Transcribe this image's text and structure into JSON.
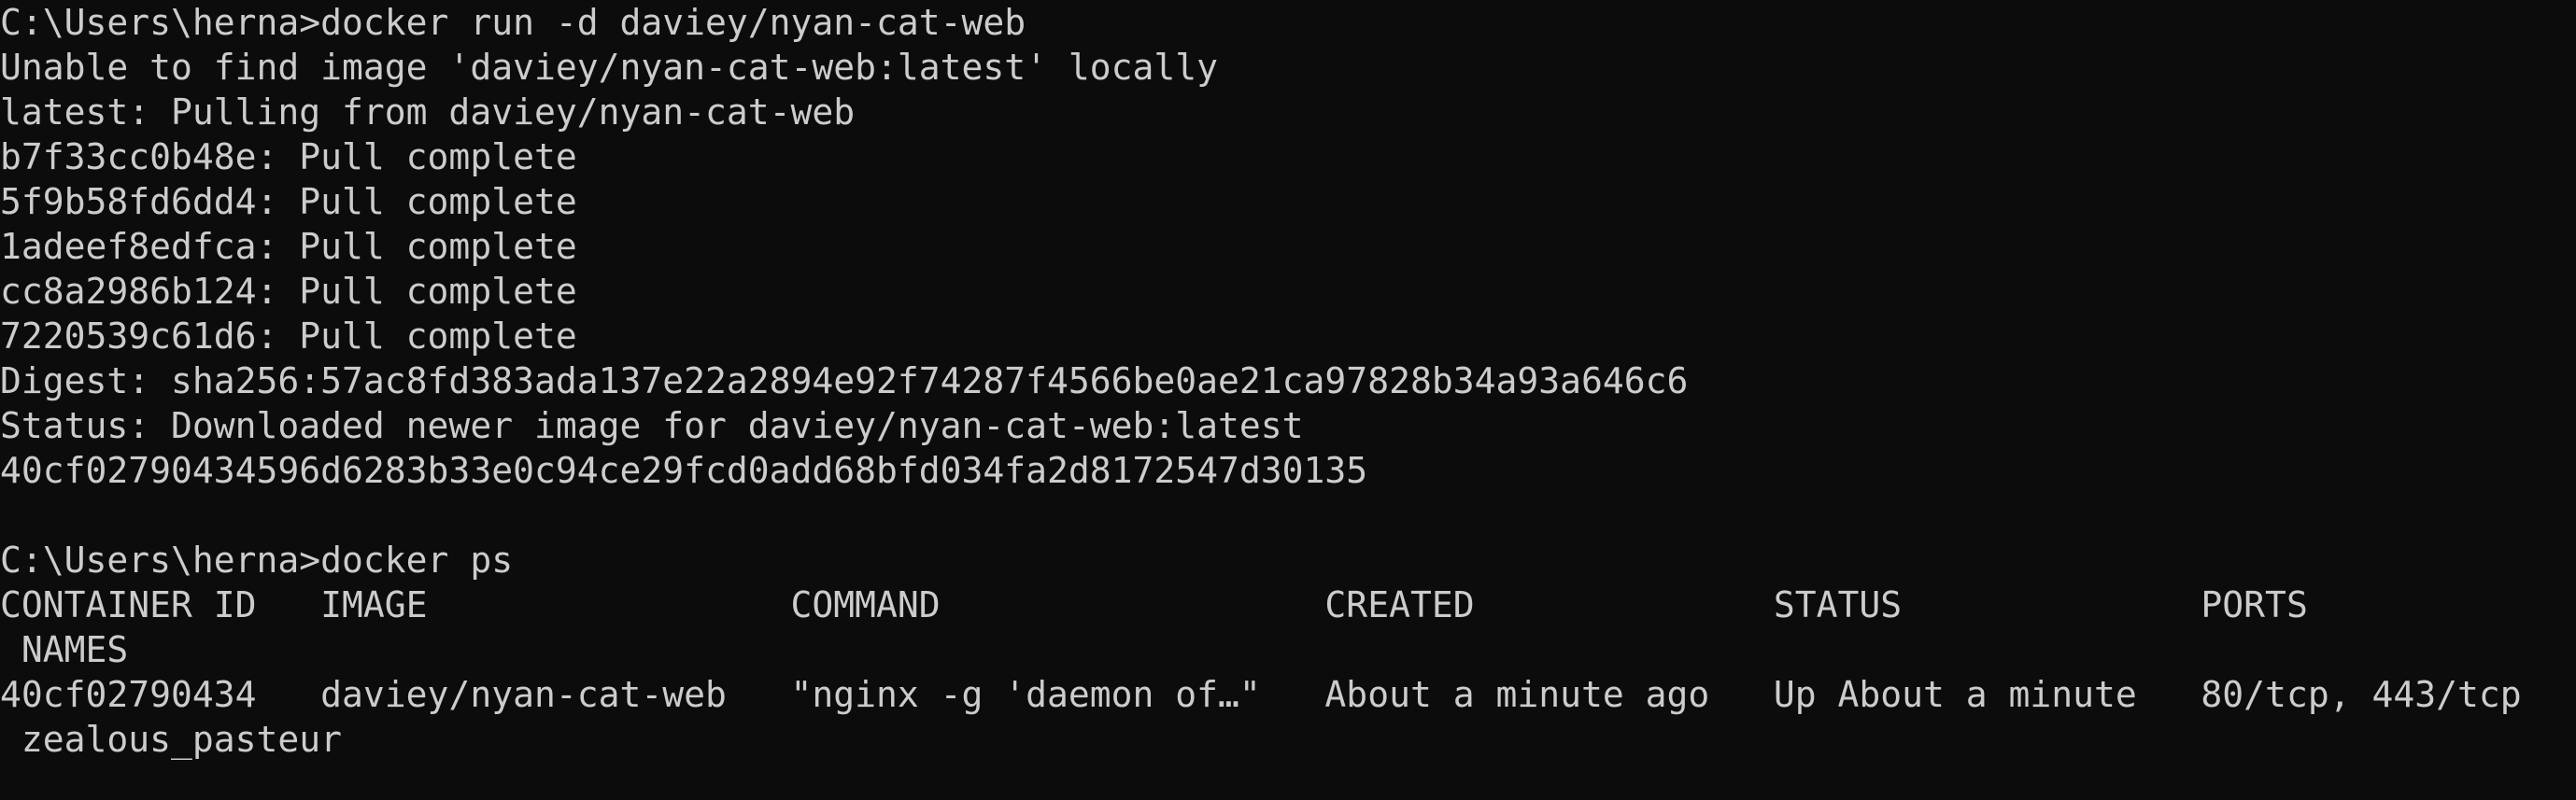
{
  "terminal": {
    "lines": [
      "C:\\Users\\herna>docker run -d daviey/nyan-cat-web",
      "Unable to find image 'daviey/nyan-cat-web:latest' locally",
      "latest: Pulling from daviey/nyan-cat-web",
      "b7f33cc0b48e: Pull complete",
      "5f9b58fd6dd4: Pull complete",
      "1adeef8edfca: Pull complete",
      "cc8a2986b124: Pull complete",
      "7220539c61d6: Pull complete",
      "Digest: sha256:57ac8fd383ada137e22a2894e92f74287f4566be0ae21ca97828b34a93a646c6",
      "Status: Downloaded newer image for daviey/nyan-cat-web:latest",
      "40cf02790434596d6283b33e0c94ce29fcd0add68bfd034fa2d8172547d30135",
      "",
      "C:\\Users\\herna>docker ps",
      "CONTAINER ID   IMAGE                 COMMAND                  CREATED              STATUS              PORTS",
      " NAMES",
      "40cf02790434   daviey/nyan-cat-web   \"nginx -g 'daemon of…\"   About a minute ago   Up About a minute   80/tcp, 443/tcp",
      " zealous_pasteur"
    ]
  }
}
